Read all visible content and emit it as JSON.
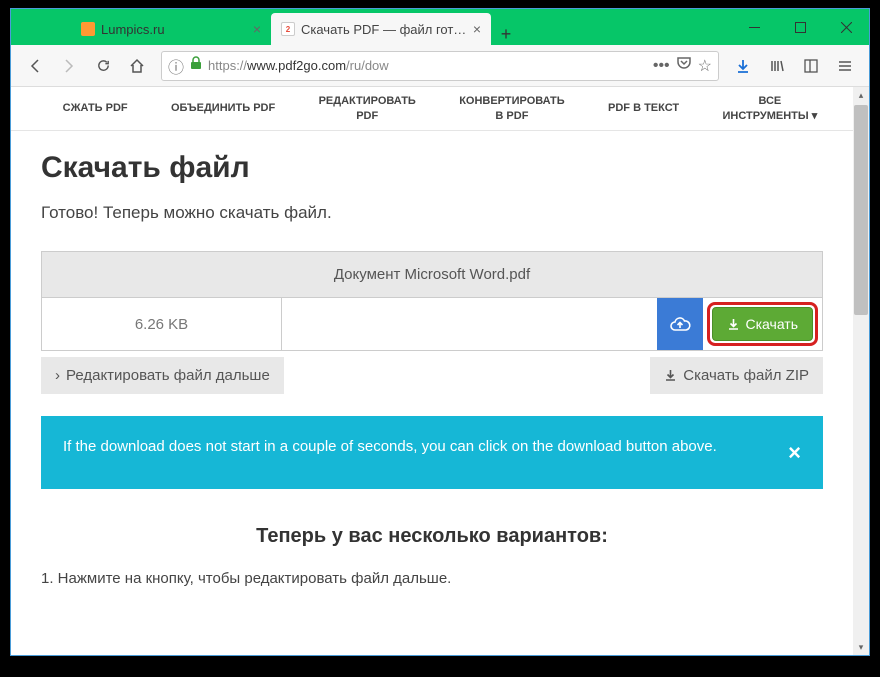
{
  "browser": {
    "tabs": [
      {
        "title": "Lumpics.ru",
        "favicon": "orange"
      },
      {
        "title": "Скачать PDF — файл готов дл",
        "favicon": "p2g"
      }
    ],
    "url_prefix": "https://",
    "url_host": "www.pdf2go.com",
    "url_path": "/ru/dow"
  },
  "nav": {
    "items": [
      "СЖАТЬ PDF",
      "ОБЪЕДИНИТЬ PDF",
      "РЕДАКТИРОВАТЬ\nPDF",
      "КОНВЕРТИРОВАТЬ\nВ PDF",
      "PDF В ТЕКСТ",
      "ВСЕ\nИНСТРУМЕНТЫ ▾"
    ]
  },
  "page": {
    "title": "Скачать файл",
    "subtitle": "Готово! Теперь можно скачать файл.",
    "file": {
      "name": "Документ Microsoft Word.pdf",
      "size": "6.26 KB",
      "download_label": "Скачать"
    },
    "edit_more": "Редактировать файл дальше",
    "download_zip": "Скачать файл ZIP",
    "alert": "If the download does not start in a couple of seconds, you can click on the download button above.",
    "options_title": "Теперь у вас несколько вариантов:",
    "step1": "1. Нажмите на кнопку, чтобы редактировать файл дальше."
  }
}
